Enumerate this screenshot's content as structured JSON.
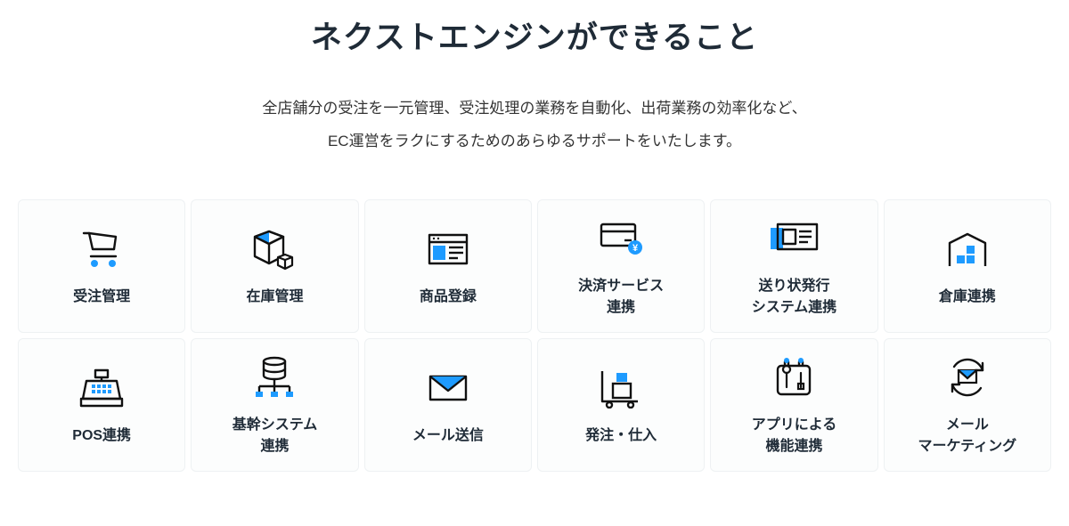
{
  "heading": "ネクストエンジンができること",
  "lead_line1": "全店舗分の受注を一元管理、受注処理の業務を自動化、出荷業務の効率化など、",
  "lead_line2": "EC運営をラクにするためのあらゆるサポートをいたします。",
  "colors": {
    "accent": "#1e9bff",
    "stroke": "#111"
  },
  "features": [
    {
      "icon": "cart",
      "label": "受注管理"
    },
    {
      "icon": "box",
      "label": "在庫管理"
    },
    {
      "icon": "register",
      "label": "商品登録"
    },
    {
      "icon": "payment",
      "label": "決済サービス\n連携"
    },
    {
      "icon": "shippinglabel",
      "label": "送り状発行\nシステム連携"
    },
    {
      "icon": "warehouse",
      "label": "倉庫連携"
    },
    {
      "icon": "pos",
      "label": "POS連携"
    },
    {
      "icon": "core",
      "label": "基幹システム\n連携"
    },
    {
      "icon": "mail",
      "label": "メール送信"
    },
    {
      "icon": "purchase",
      "label": "発注・仕入"
    },
    {
      "icon": "apps",
      "label": "アプリによる\n機能連携"
    },
    {
      "icon": "mailmkt",
      "label": "メール\nマーケティング"
    }
  ]
}
